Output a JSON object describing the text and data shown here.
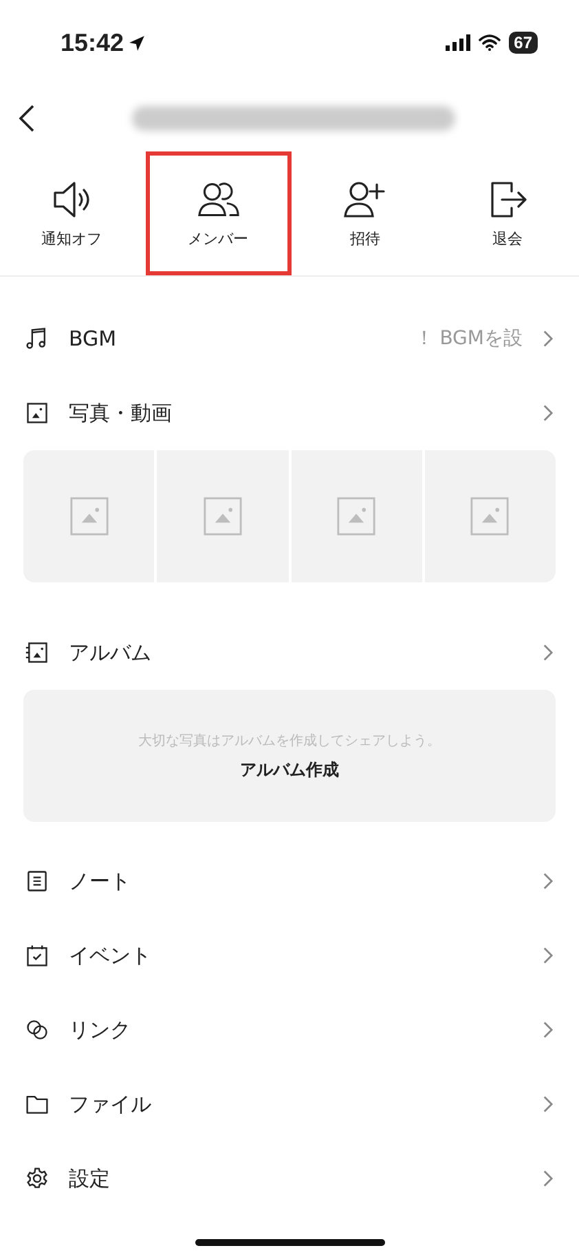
{
  "status_bar": {
    "time": "15:42",
    "battery": "67"
  },
  "header": {
    "title_blurred": true
  },
  "actions": [
    {
      "label": "通知オフ",
      "highlighted": false
    },
    {
      "label": "メンバー",
      "highlighted": true
    },
    {
      "label": "招待",
      "highlighted": false
    },
    {
      "label": "退会",
      "highlighted": false
    }
  ],
  "menu": [
    {
      "kind": "music",
      "label": "BGM",
      "value": "！ BGMを設"
    },
    {
      "kind": "media",
      "label": "写真・動画",
      "thumbnails": [
        {
          "kind": "placeholder"
        },
        {
          "kind": "placeholder"
        },
        {
          "kind": "placeholder"
        },
        {
          "kind": "placeholder"
        }
      ]
    },
    {
      "kind": "album",
      "label": "アルバム",
      "hint": "大切な写真はアルバムを作成してシェアしよう。",
      "button": "アルバム作成"
    },
    {
      "kind": "plain",
      "label": "ノート"
    },
    {
      "kind": "plain",
      "label": "イベント"
    },
    {
      "kind": "plain",
      "label": "リンク"
    },
    {
      "kind": "plain",
      "label": "ファイル"
    },
    {
      "kind": "plain",
      "label": "設定"
    }
  ]
}
